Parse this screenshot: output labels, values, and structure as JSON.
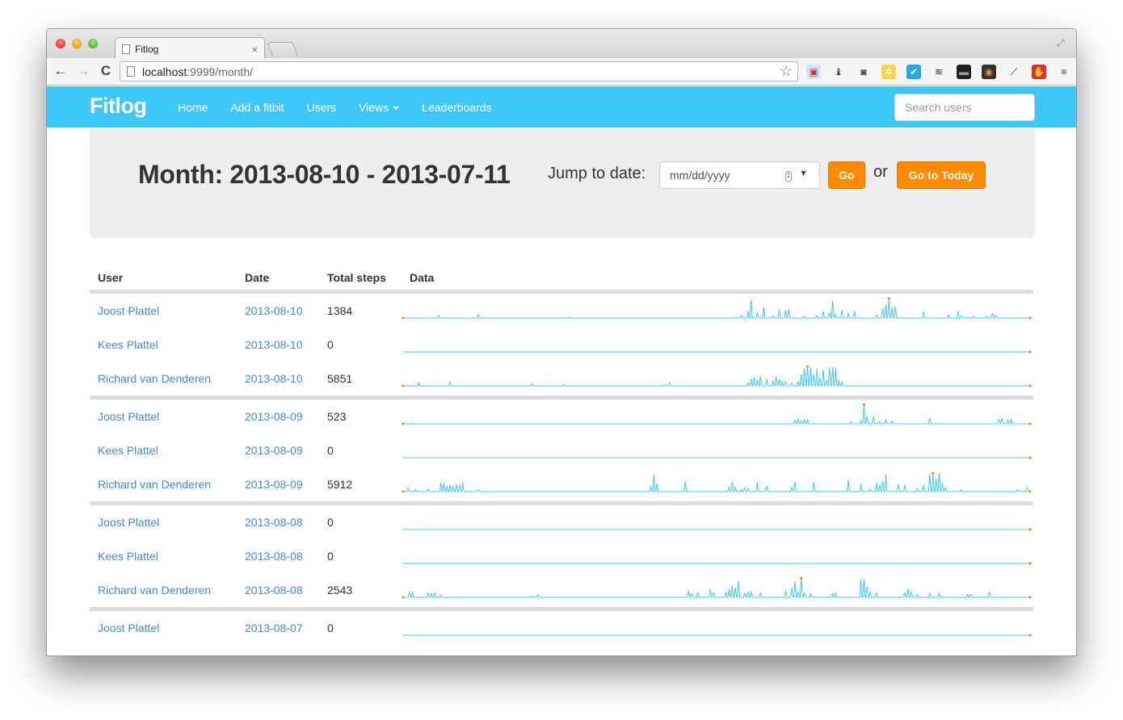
{
  "browser": {
    "tab_title": "Fitlog",
    "tab_close": "×",
    "url_host": "localhost",
    "url_rest": ":9999/month/",
    "back": "←",
    "forward": "→",
    "reload": "C",
    "bookmark": "☆",
    "fullscreen": "⤢",
    "extensions": [
      {
        "name": "bookmark-folder-icon",
        "glyph": "▣",
        "bg": "#cfe6f7",
        "fg": "#d33"
      },
      {
        "name": "lamp-icon",
        "glyph": "♝",
        "bg": "transparent",
        "fg": "#444"
      },
      {
        "name": "evernote-clipper-icon",
        "glyph": "◙",
        "bg": "transparent",
        "fg": "#444"
      },
      {
        "name": "puzzle-yellow-icon",
        "glyph": "✲",
        "bg": "#f6d54a",
        "fg": "#fff"
      },
      {
        "name": "checkmark-icon",
        "glyph": "✔",
        "bg": "#2aa6de",
        "fg": "#fff"
      },
      {
        "name": "layers-icon",
        "glyph": "≋",
        "bg": "transparent",
        "fg": "#222"
      },
      {
        "name": "terminal-icon",
        "glyph": "▬",
        "bg": "#222",
        "fg": "#999"
      },
      {
        "name": "color-wheel-icon",
        "glyph": "◉",
        "bg": "#333",
        "fg": "#e84"
      },
      {
        "name": "eyedropper-icon",
        "glyph": "⟋",
        "bg": "transparent",
        "fg": "#333"
      },
      {
        "name": "adblock-icon",
        "glyph": "✋",
        "bg": "#d32",
        "fg": "#fff"
      },
      {
        "name": "menu-icon",
        "glyph": "≡",
        "bg": "transparent",
        "fg": "#333"
      }
    ]
  },
  "navbar": {
    "brand": "Fitlog",
    "links": [
      "Home",
      "Add a fitbit",
      "Users",
      "Views",
      "Leaderboards"
    ],
    "search_placeholder": "Search users",
    "accent": "#3ec8fa"
  },
  "header": {
    "title": "Month: 2013-08-10 - 2013-07-11",
    "jump_label": "Jump to date:",
    "date_placeholder": "mm/dd/yyyy",
    "go_label": "Go",
    "or_label": "or",
    "today_label": "Go to Today",
    "button_color": "#ff8c00"
  },
  "table": {
    "columns": [
      "User",
      "Date",
      "Total steps",
      "Data"
    ],
    "line_color": "#3ec8fa",
    "marker_color": "#ff8c00",
    "rows": [
      {
        "user": "Joost Plattel",
        "date": "2013-08-10",
        "steps": "1384",
        "group_end": false,
        "spikes": [
          [
            0.056,
            0.12
          ],
          [
            0.12,
            0.2
          ],
          [
            0.265,
            0.06
          ],
          [
            0.53,
            0.08
          ],
          [
            0.54,
            0.15
          ],
          [
            0.55,
            0.35
          ],
          [
            0.555,
            0.95
          ],
          [
            0.565,
            0.3
          ],
          [
            0.575,
            0.55
          ],
          [
            0.59,
            0.12
          ],
          [
            0.6,
            0.45
          ],
          [
            0.61,
            0.4
          ],
          [
            0.615,
            0.45
          ],
          [
            0.64,
            0.1
          ],
          [
            0.66,
            0.12
          ],
          [
            0.67,
            0.35
          ],
          [
            0.68,
            0.3
          ],
          [
            0.685,
            0.9
          ],
          [
            0.69,
            0.2
          ],
          [
            0.7,
            0.4
          ],
          [
            0.71,
            0.25
          ],
          [
            0.72,
            0.35
          ],
          [
            0.755,
            0.15
          ],
          [
            0.765,
            0.5
          ],
          [
            0.77,
            0.7
          ],
          [
            0.775,
            1.0
          ],
          [
            0.78,
            0.55
          ],
          [
            0.785,
            0.6
          ],
          [
            0.83,
            0.35
          ],
          [
            0.87,
            0.15
          ],
          [
            0.885,
            0.35
          ],
          [
            0.89,
            0.12
          ],
          [
            0.91,
            0.1
          ],
          [
            0.93,
            0.1
          ],
          [
            0.94,
            0.25
          ],
          [
            0.945,
            0.15
          ]
        ],
        "peak": 0.775,
        "end_marker": true
      },
      {
        "user": "Kees Plattel",
        "date": "2013-08-10",
        "steps": "0",
        "group_end": false,
        "spikes": [],
        "peak": null,
        "end_marker": true
      },
      {
        "user": "Richard van Denderen",
        "date": "2013-08-10",
        "steps": "5851",
        "group_end": true,
        "spikes": [
          [
            0.025,
            0.15
          ],
          [
            0.075,
            0.18
          ],
          [
            0.205,
            0.1
          ],
          [
            0.255,
            0.05
          ],
          [
            0.415,
            0.05
          ],
          [
            0.425,
            0.18
          ],
          [
            0.55,
            0.15
          ],
          [
            0.555,
            0.35
          ],
          [
            0.56,
            0.45
          ],
          [
            0.565,
            0.3
          ],
          [
            0.57,
            0.5
          ],
          [
            0.58,
            0.35
          ],
          [
            0.59,
            0.3
          ],
          [
            0.595,
            0.5
          ],
          [
            0.6,
            0.35
          ],
          [
            0.605,
            0.25
          ],
          [
            0.61,
            0.2
          ],
          [
            0.62,
            0.15
          ],
          [
            0.63,
            0.2
          ],
          [
            0.635,
            0.6
          ],
          [
            0.64,
            0.9
          ],
          [
            0.645,
            1.0
          ],
          [
            0.65,
            0.95
          ],
          [
            0.655,
            0.6
          ],
          [
            0.66,
            0.9
          ],
          [
            0.665,
            0.4
          ],
          [
            0.67,
            0.85
          ],
          [
            0.675,
            0.3
          ],
          [
            0.68,
            0.95
          ],
          [
            0.685,
            0.95
          ],
          [
            0.69,
            0.95
          ],
          [
            0.695,
            0.3
          ],
          [
            0.7,
            0.2
          ]
        ],
        "peak": 0.645,
        "end_marker": true
      },
      {
        "user": "Joost Plattel",
        "date": "2013-08-09",
        "steps": "523",
        "group_end": false,
        "spikes": [
          [
            0.625,
            0.2
          ],
          [
            0.63,
            0.25
          ],
          [
            0.635,
            0.15
          ],
          [
            0.64,
            0.22
          ],
          [
            0.645,
            0.25
          ],
          [
            0.715,
            0.1
          ],
          [
            0.73,
            0.15
          ],
          [
            0.735,
            1.0
          ],
          [
            0.74,
            0.4
          ],
          [
            0.75,
            0.4
          ],
          [
            0.76,
            0.12
          ],
          [
            0.77,
            0.2
          ],
          [
            0.78,
            0.15
          ],
          [
            0.84,
            0.3
          ],
          [
            0.95,
            0.25
          ],
          [
            0.955,
            0.3
          ],
          [
            0.965,
            0.18
          ],
          [
            0.97,
            0.25
          ]
        ],
        "peak": 0.735,
        "end_marker": true
      },
      {
        "user": "Kees Plattel",
        "date": "2013-08-09",
        "steps": "0",
        "group_end": false,
        "spikes": [],
        "peak": null,
        "end_marker": true
      },
      {
        "user": "Richard van Denderen",
        "date": "2013-08-09",
        "steps": "5912",
        "group_end": true,
        "spikes": [
          [
            0.008,
            0.2
          ],
          [
            0.02,
            0.1
          ],
          [
            0.04,
            0.15
          ],
          [
            0.06,
            0.45
          ],
          [
            0.065,
            0.45
          ],
          [
            0.07,
            0.3
          ],
          [
            0.075,
            0.35
          ],
          [
            0.08,
            0.3
          ],
          [
            0.085,
            0.4
          ],
          [
            0.09,
            0.35
          ],
          [
            0.095,
            0.5
          ],
          [
            0.12,
            0.1
          ],
          [
            0.395,
            0.3
          ],
          [
            0.4,
            0.9
          ],
          [
            0.405,
            0.4
          ],
          [
            0.45,
            0.55
          ],
          [
            0.52,
            0.25
          ],
          [
            0.525,
            0.5
          ],
          [
            0.53,
            0.25
          ],
          [
            0.54,
            0.1
          ],
          [
            0.545,
            0.2
          ],
          [
            0.55,
            0.15
          ],
          [
            0.565,
            0.5
          ],
          [
            0.58,
            0.3
          ],
          [
            0.62,
            0.25
          ],
          [
            0.625,
            0.5
          ],
          [
            0.655,
            0.5
          ],
          [
            0.71,
            0.6
          ],
          [
            0.73,
            0.4
          ],
          [
            0.745,
            0.15
          ],
          [
            0.755,
            0.45
          ],
          [
            0.76,
            0.35
          ],
          [
            0.765,
            0.55
          ],
          [
            0.77,
            0.9
          ],
          [
            0.79,
            0.4
          ],
          [
            0.8,
            0.35
          ],
          [
            0.82,
            0.15
          ],
          [
            0.83,
            0.35
          ],
          [
            0.84,
            0.9
          ],
          [
            0.845,
            0.95
          ],
          [
            0.85,
            0.65
          ],
          [
            0.855,
            0.95
          ],
          [
            0.86,
            0.45
          ],
          [
            0.865,
            0.2
          ],
          [
            0.89,
            0.1
          ],
          [
            0.98,
            0.1
          ],
          [
            0.995,
            0.2
          ]
        ],
        "peak": 0.845,
        "end_marker": true
      },
      {
        "user": "Joost Plattel",
        "date": "2013-08-08",
        "steps": "0",
        "group_end": false,
        "spikes": [],
        "peak": null,
        "end_marker": true
      },
      {
        "user": "Kees Plattel",
        "date": "2013-08-08",
        "steps": "0",
        "group_end": false,
        "spikes": [],
        "peak": null,
        "end_marker": true
      },
      {
        "user": "Richard van Denderen",
        "date": "2013-08-08",
        "steps": "2543",
        "group_end": true,
        "spikes": [
          [
            0.01,
            0.3
          ],
          [
            0.015,
            0.3
          ],
          [
            0.04,
            0.25
          ],
          [
            0.045,
            0.2
          ],
          [
            0.05,
            0.25
          ],
          [
            0.06,
            0.12
          ],
          [
            0.205,
            0.05
          ],
          [
            0.215,
            0.15
          ],
          [
            0.455,
            0.35
          ],
          [
            0.46,
            0.2
          ],
          [
            0.47,
            0.25
          ],
          [
            0.49,
            0.4
          ],
          [
            0.495,
            0.25
          ],
          [
            0.515,
            0.3
          ],
          [
            0.52,
            0.45
          ],
          [
            0.525,
            0.6
          ],
          [
            0.53,
            0.5
          ],
          [
            0.535,
            0.85
          ],
          [
            0.545,
            0.2
          ],
          [
            0.55,
            0.3
          ],
          [
            0.555,
            0.3
          ],
          [
            0.57,
            0.25
          ],
          [
            0.61,
            0.35
          ],
          [
            0.62,
            0.5
          ],
          [
            0.625,
            0.85
          ],
          [
            0.63,
            0.3
          ],
          [
            0.635,
            1.0
          ],
          [
            0.64,
            0.25
          ],
          [
            0.65,
            0.2
          ],
          [
            0.685,
            0.2
          ],
          [
            0.69,
            0.25
          ],
          [
            0.73,
            0.95
          ],
          [
            0.735,
            0.95
          ],
          [
            0.74,
            0.55
          ],
          [
            0.745,
            0.3
          ],
          [
            0.755,
            0.25
          ],
          [
            0.8,
            0.25
          ],
          [
            0.805,
            0.45
          ],
          [
            0.81,
            0.3
          ],
          [
            0.82,
            0.15
          ],
          [
            0.84,
            0.2
          ],
          [
            0.855,
            0.2
          ],
          [
            0.9,
            0.15
          ],
          [
            0.905,
            0.15
          ],
          [
            0.935,
            0.3
          ]
        ],
        "peak": 0.635,
        "end_marker": true
      },
      {
        "user": "Joost Plattel",
        "date": "2013-08-07",
        "steps": "0",
        "group_end": false,
        "spikes": [],
        "peak": null,
        "end_marker": true
      }
    ]
  }
}
